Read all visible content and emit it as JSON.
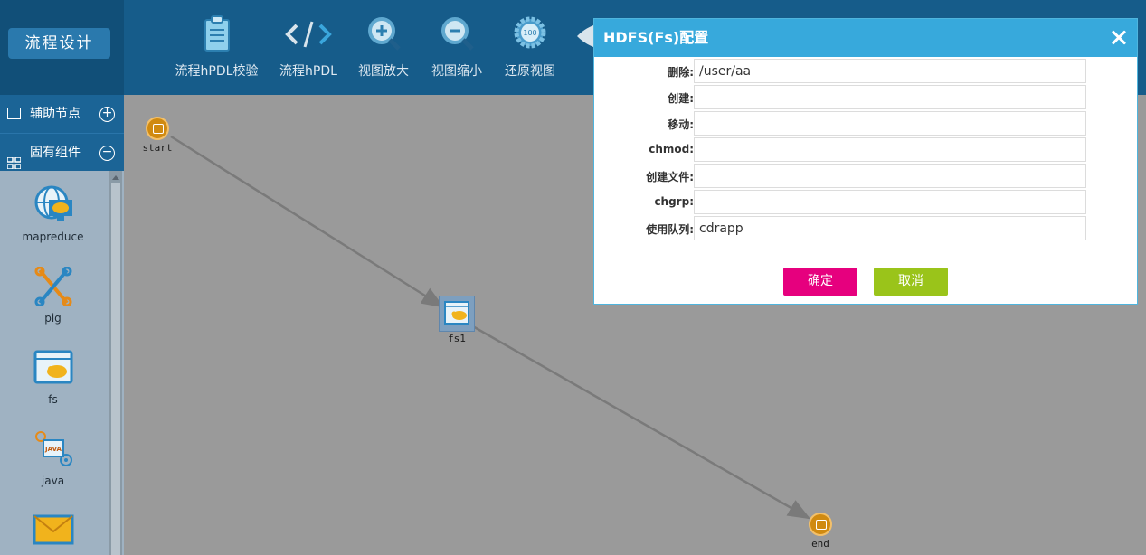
{
  "header": {
    "brand": "流程设计",
    "tools": [
      {
        "label": "流程hPDL校验",
        "icon": "clipboard-icon"
      },
      {
        "label": "流程hPDL",
        "icon": "code-icon"
      },
      {
        "label": "视图放大",
        "icon": "zoom-in-icon"
      },
      {
        "label": "视图缩小",
        "icon": "zoom-out-icon"
      },
      {
        "label": "还原视图",
        "icon": "reset-view-icon"
      }
    ]
  },
  "sidebar": {
    "aux_label": "辅助节点",
    "comp_label": "固有组件",
    "palette": [
      {
        "label": "mapreduce",
        "icon": "mapreduce-icon"
      },
      {
        "label": "pig",
        "icon": "pig-icon"
      },
      {
        "label": "fs",
        "icon": "fs-icon"
      },
      {
        "label": "java",
        "icon": "java-icon"
      },
      {
        "label": "",
        "icon": "email-icon"
      }
    ]
  },
  "canvas": {
    "nodes": [
      {
        "id": "start",
        "label": "start",
        "icon": "start-node-icon"
      },
      {
        "id": "fs1",
        "label": "fs1",
        "icon": "fs-node-icon"
      },
      {
        "id": "end",
        "label": "end",
        "icon": "end-node-icon"
      }
    ]
  },
  "modal": {
    "title": "HDFS(Fs)配置",
    "fields": [
      {
        "label": "删除:",
        "value": "/user/aa"
      },
      {
        "label": "创建:",
        "value": ""
      },
      {
        "label": "移动:",
        "value": ""
      },
      {
        "label": "chmod:",
        "value": ""
      },
      {
        "label": "创建文件:",
        "value": ""
      },
      {
        "label": "chgrp:",
        "value": ""
      },
      {
        "label": "使用队列:",
        "value": "cdrapp"
      }
    ],
    "ok_label": "确定",
    "cancel_label": "取消"
  },
  "colors": {
    "header_bg": "#165c8a",
    "modal_header": "#37a9dc",
    "ok_button": "#e6007e",
    "cancel_button": "#9ac41a",
    "node_orange": "#d08a10"
  }
}
